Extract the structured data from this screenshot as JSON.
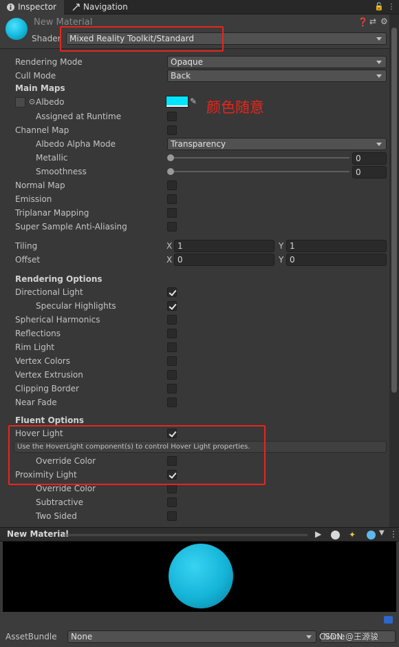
{
  "tabs": [
    {
      "label": "Inspector",
      "icon": "info-icon"
    },
    {
      "label": "Navigation",
      "icon": "navigation-icon"
    }
  ],
  "material": {
    "name": "New Material",
    "shader_label": "Shader",
    "shader_value": "Mixed Reality Toolkit/Standard"
  },
  "properties": {
    "rendering_mode": {
      "label": "Rendering Mode",
      "value": "Opaque"
    },
    "cull_mode": {
      "label": "Cull Mode",
      "value": "Back"
    },
    "main_maps": "Main Maps",
    "albedo": {
      "label": "Albedo",
      "color": "#00e5ff"
    },
    "annotation_text": "颜色随意",
    "assigned_runtime": "Assigned at Runtime",
    "channel_map": "Channel Map",
    "albedo_alpha_mode": {
      "label": "Albedo Alpha Mode",
      "value": "Transparency"
    },
    "metallic": {
      "label": "Metallic",
      "value": "0"
    },
    "smoothness": {
      "label": "Smoothness",
      "value": "0"
    },
    "normal_map": "Normal Map",
    "emission": "Emission",
    "triplanar": "Triplanar Mapping",
    "super_sample": "Super Sample Anti-Aliasing",
    "tiling": {
      "label": "Tiling",
      "x_label": "X",
      "x": "1",
      "y_label": "Y",
      "y": "1"
    },
    "offset": {
      "label": "Offset",
      "x_label": "X",
      "x": "0",
      "y_label": "Y",
      "y": "0"
    },
    "rendering_options": "Rendering Options",
    "directional_light": "Directional Light",
    "specular": "Specular Highlights",
    "spherical": "Spherical Harmonics",
    "reflections": "Reflections",
    "rim_light": "Rim Light",
    "vertex_colors": "Vertex Colors",
    "vertex_extrusion": "Vertex Extrusion",
    "clipping_border": "Clipping Border",
    "near_fade": "Near Fade",
    "fluent_options": "Fluent Options",
    "hover_light": "Hover Light",
    "hover_help": "Use the HoverLight component(s) to control Hover Light properties.",
    "override_color_1": "Override Color",
    "proximity_light": "Proximity Light",
    "override_color_2": "Override Color",
    "subtractive": "Subtractive",
    "two_sided": "Two Sided"
  },
  "preview": {
    "title": "New Material"
  },
  "asset_bundle": {
    "label": "AssetBundle",
    "value": "None",
    "variant": "None",
    "watermark": "CSDN @王源骏"
  },
  "colors": {
    "accent_annotation": "#e8261c",
    "albedo": "#00e5ff"
  }
}
